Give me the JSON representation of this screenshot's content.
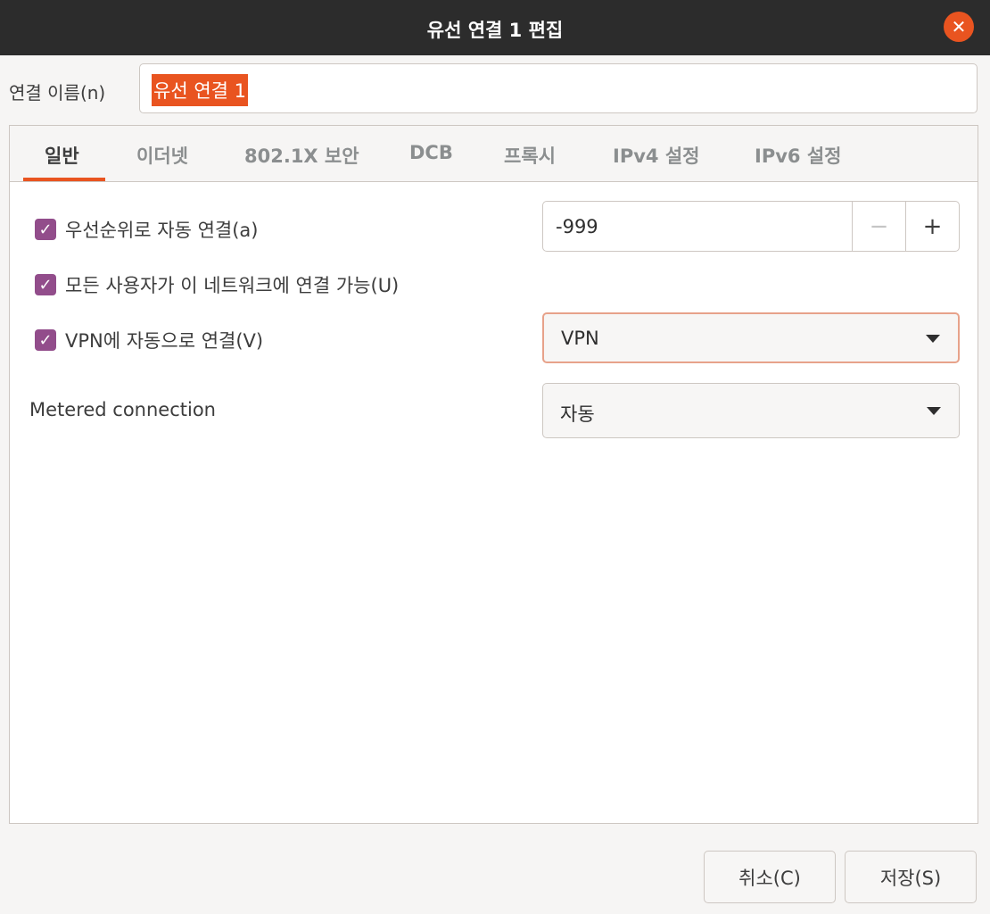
{
  "window": {
    "title": "유선 연결 1 편집"
  },
  "connection_name": {
    "label": "연결 이름(n)",
    "value": "유선 연결 1"
  },
  "tabs": [
    {
      "label": "일반",
      "active": true
    },
    {
      "label": "이더넷"
    },
    {
      "label": "802.1X 보안"
    },
    {
      "label": "DCB"
    },
    {
      "label": "프록시"
    },
    {
      "label": "IPv4 설정"
    },
    {
      "label": "IPv6 설정"
    }
  ],
  "general": {
    "auto_connect_priority": {
      "label": "우선순위로 자동 연결(a)",
      "checked": true,
      "priority_value": "-999"
    },
    "all_users": {
      "label": "모든 사용자가 이 네트워크에 연결 가능(U)",
      "checked": true
    },
    "auto_vpn": {
      "label": "VPN에 자동으로 연결(V)",
      "checked": true,
      "selected": "VPN"
    },
    "metered": {
      "label": "Metered connection",
      "selected": "자동"
    }
  },
  "spin_buttons": {
    "minus": "−",
    "plus": "+"
  },
  "buttons": {
    "cancel": "취소(C)",
    "save": "저장(S)"
  },
  "colors": {
    "accent": "#e95420",
    "checkbox": "#924d8b",
    "titlebar": "#2c2c2c"
  },
  "icons": {
    "close": "close-icon",
    "check": "check-icon",
    "dropdown": "chevron-down-icon"
  }
}
